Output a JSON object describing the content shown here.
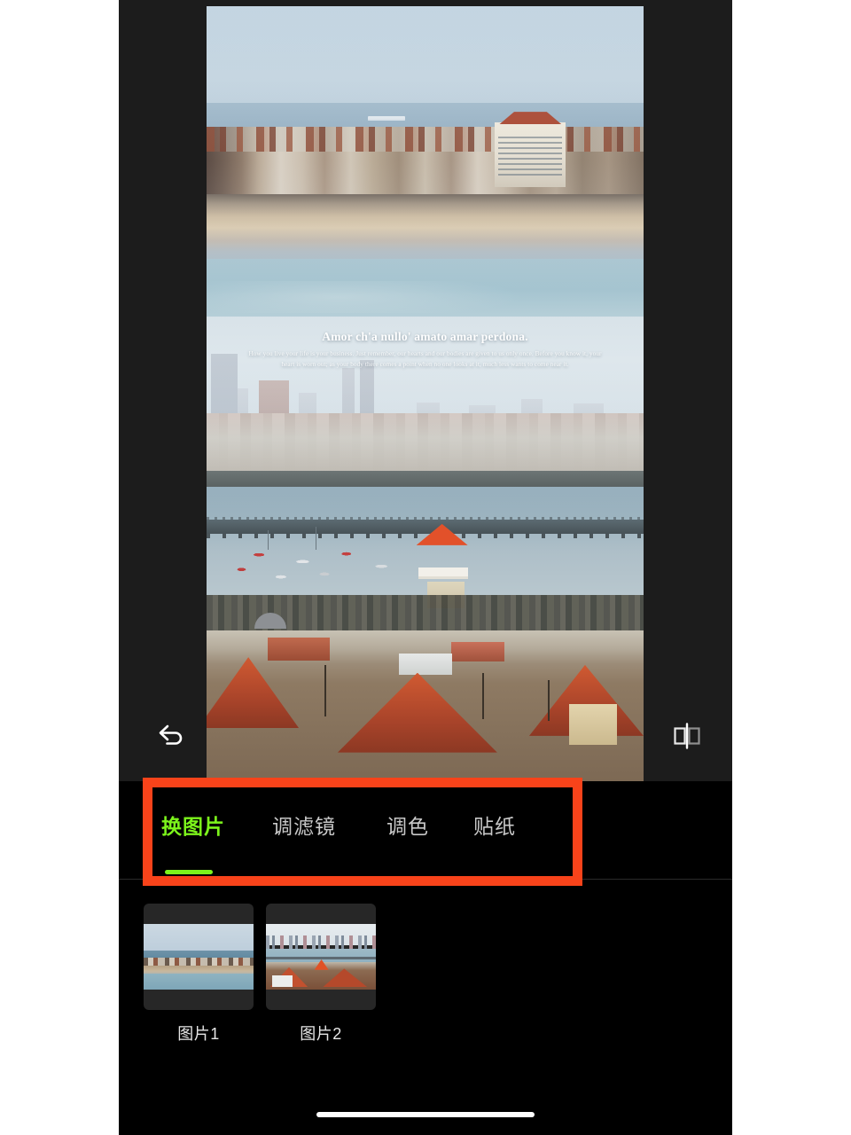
{
  "app": {
    "background_color": "#000000",
    "page_background": "#ffffff",
    "accent_color": "#7cf41b",
    "annotation_color": "#f8431a"
  },
  "canvas": {
    "name": "poster-canvas",
    "overlay_title": "Amor ch'a nullo' amato amar perdona.",
    "overlay_body": "How you live your life is your business. Just remember, our hearts and our bodies are given to us only once. Before you know it, your heart is worn out; as your body there comes a point when no one looks at it, much less wants to come near it."
  },
  "edit_toolbar": {
    "undo": {
      "label": "undo",
      "icon": "undo-arrow-icon"
    },
    "flip": {
      "label": "flip",
      "icon": "mirror-flip-icon"
    }
  },
  "panel": {
    "tabs": [
      {
        "label": "换图片",
        "active": true
      },
      {
        "label": "调滤镜",
        "active": false
      },
      {
        "label": "调色",
        "active": false
      },
      {
        "label": "贴纸",
        "active": false
      }
    ],
    "thumbnails": [
      {
        "label": "图片1",
        "selected": true
      },
      {
        "label": "图片2",
        "selected": false
      }
    ]
  }
}
